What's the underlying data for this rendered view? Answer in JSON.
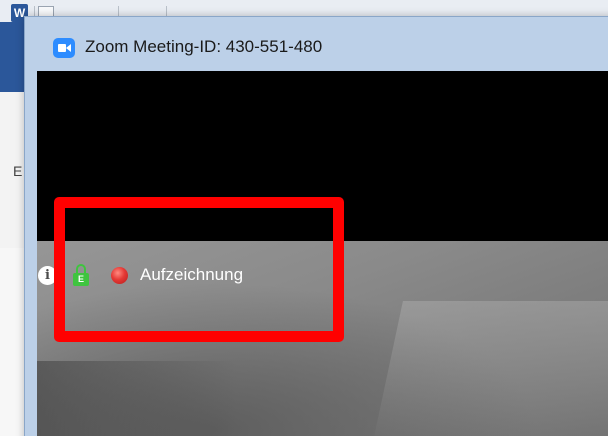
{
  "background_app": {
    "icon_letter": "W",
    "partial_text": "E"
  },
  "window": {
    "title": "Zoom Meeting-ID: 430-551-480"
  },
  "status": {
    "info_icon": "info-icon",
    "info_glyph": "i",
    "lock_icon": "lock-icon",
    "lock_letter": "E",
    "recording_icon": "record-icon",
    "recording_label": "Aufzeichnung"
  },
  "colors": {
    "zoom_blue": "#2d8cff",
    "lock_green": "#3fc43f",
    "record_red": "#e53935",
    "highlight_red": "#ff0000",
    "titlebar": "#bcd0e8"
  }
}
